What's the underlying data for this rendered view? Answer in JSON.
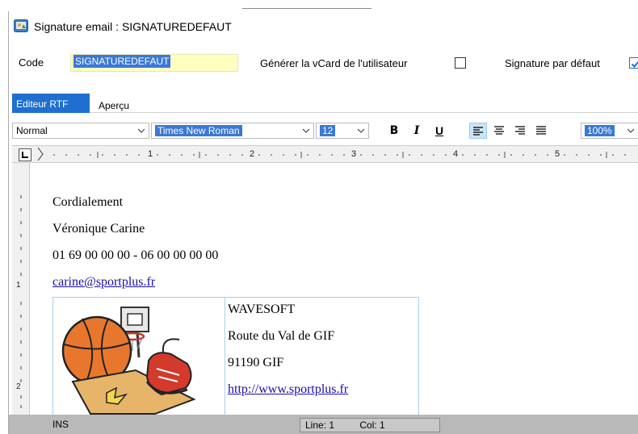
{
  "window": {
    "title": "Signature email : SIGNATUREDEFAUT"
  },
  "form": {
    "code_label": "Code",
    "code_value": "SIGNATUREDEFAUT",
    "vcard_label": "Générer la vCard de l'utilisateur",
    "vcard_checked": false,
    "default_label": "Signature par défaut",
    "default_checked": true
  },
  "tabs": [
    {
      "label": "Editeur RTF",
      "active": true
    },
    {
      "label": "Aperçu",
      "active": false
    }
  ],
  "toolbar": {
    "style": "Normal",
    "font": "Times New Roman",
    "size": "12",
    "bold": "B",
    "italic": "I",
    "underline": "U",
    "zoom": "100%"
  },
  "ruler": {
    "marks": [
      "1",
      "2",
      "3",
      "4",
      "5"
    ],
    "vmarks": [
      "1",
      "2"
    ]
  },
  "document": {
    "line1": "Cordialement",
    "line2": "Véronique Carine",
    "line3": "01 69 00 00 00 - 06 00 00 00 00",
    "email": "carine@sportplus.fr",
    "company": "WAVESOFT",
    "address1": "Route du Val de GIF",
    "address2": "91190 GIF",
    "website": "http://www.sportplus.fr"
  },
  "status": {
    "mode": "INS",
    "line": "Line: 1",
    "col": "Col: 1"
  },
  "colors": {
    "accent": "#1e6fd0",
    "selection": "#3a78d6",
    "code_bg": "#ffffc0",
    "link": "#1a0dab"
  }
}
